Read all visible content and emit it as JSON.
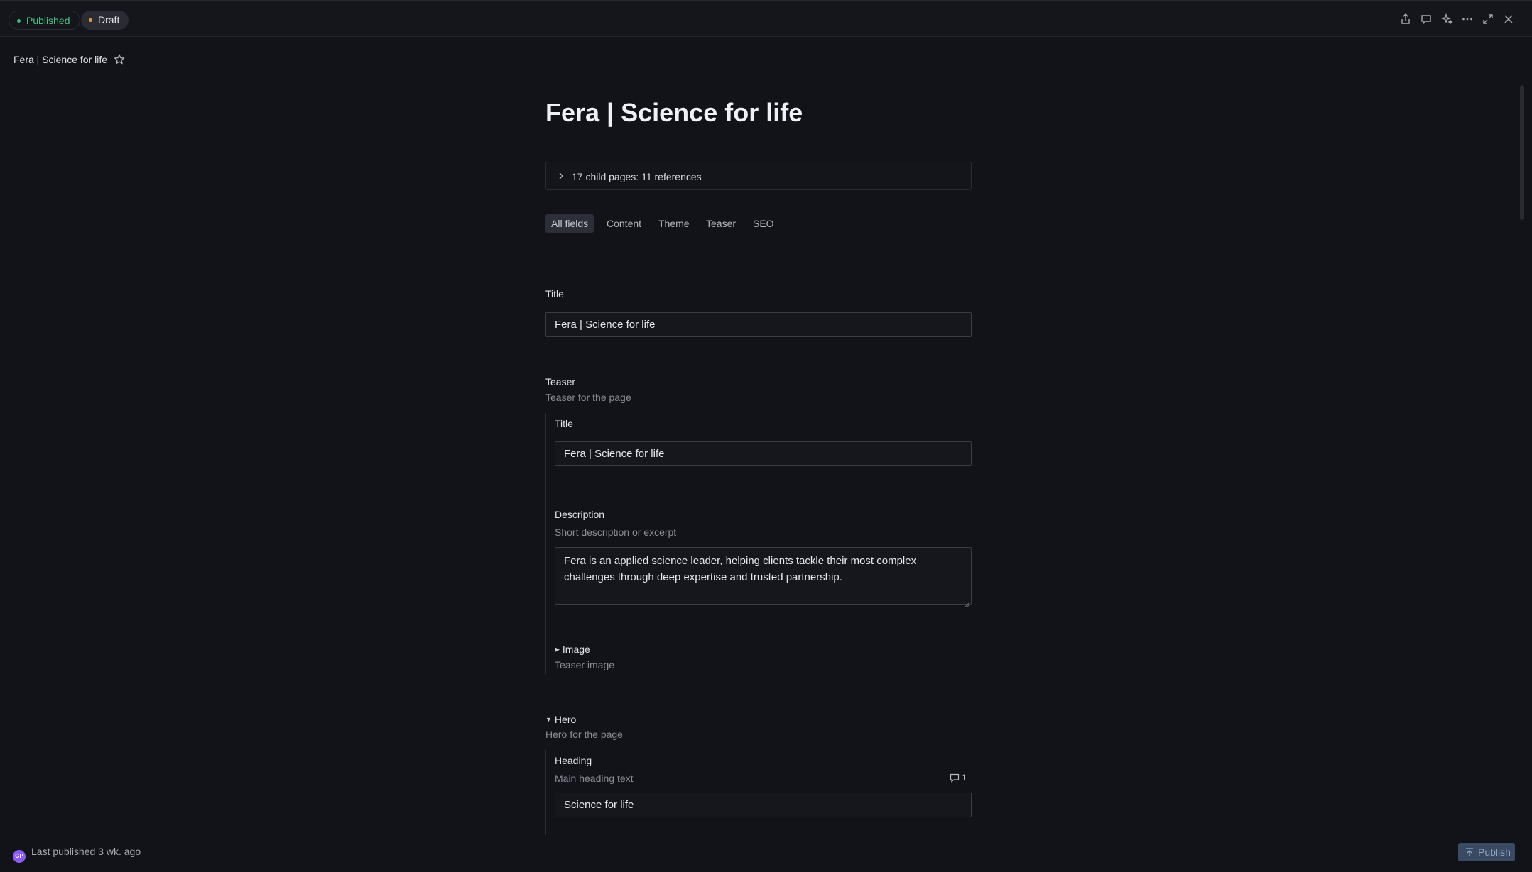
{
  "status": {
    "published_label": "Published",
    "draft_label": "Draft"
  },
  "toolbar_icons": [
    "share-icon",
    "comment-icon",
    "sparkles-icon",
    "more-icon",
    "expand-icon",
    "close-icon"
  ],
  "breadcrumb": {
    "title": "Fera | Science for life",
    "star_icon": "star-icon"
  },
  "document": {
    "title": "Fera | Science for life",
    "child_pages": "17 child pages: 11 references"
  },
  "tabs": [
    "All fields",
    "Content",
    "Theme",
    "Teaser",
    "SEO"
  ],
  "fields": {
    "title": {
      "label": "Title",
      "value": "Fera | Science for life"
    },
    "teaser": {
      "label": "Teaser",
      "description": "Teaser for the page",
      "title": {
        "label": "Title",
        "value": "Fera | Science for life"
      },
      "description_field": {
        "label": "Description",
        "hint": "Short description or excerpt",
        "value": "Fera is an applied science leader, helping clients tackle their most complex challenges through deep expertise and trusted partnership."
      },
      "image": {
        "label": "Image",
        "hint": "Teaser image"
      }
    },
    "hero": {
      "label": "Hero",
      "description": "Hero for the page",
      "heading": {
        "label": "Heading",
        "hint": "Main heading text",
        "comment_count": "1",
        "value": "Science for life"
      }
    }
  },
  "footer": {
    "avatar_initials": "GP",
    "last_published": "Last published 3 wk. ago",
    "publish_label": "Publish"
  },
  "colors": {
    "background": "#121319",
    "published": "#4cc38a",
    "draft_dot": "#e09a40",
    "avatar": "#8b5cf6",
    "publish_button": "#3a4a63"
  }
}
